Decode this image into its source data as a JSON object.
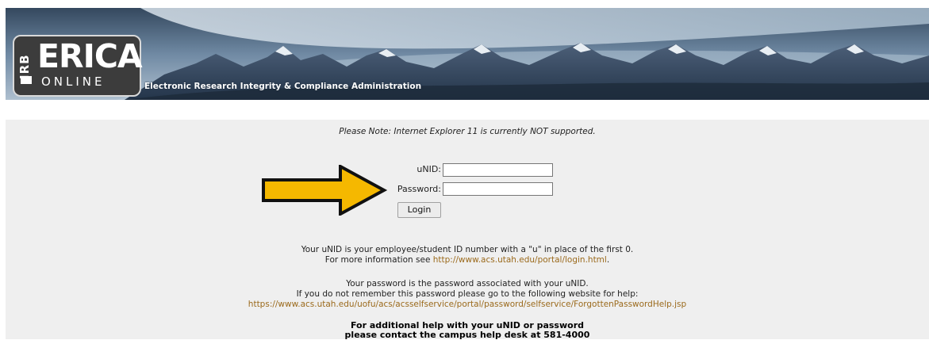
{
  "banner": {
    "logo_side_text": "IRB",
    "logo_main_text": "ERICA",
    "logo_sub_text": "ONLINE",
    "tagline": "Electronic Research Integrity & Compliance Administration"
  },
  "note": "Please Note: Internet Explorer 11 is currently NOT supported.",
  "login": {
    "unid_label": "uNID:",
    "unid_value": "",
    "password_label": "Password:",
    "password_value": "",
    "button_label": "Login"
  },
  "annotation": {
    "arrow_color": "#f5b800",
    "arrow_outline": "#111111"
  },
  "info": {
    "unid_line1": "Your uNID is your employee/student ID number with a \"u\" in place of the first 0.",
    "unid_line2_prefix": "For more information see ",
    "unid_link": "http://www.acs.utah.edu/portal/login.html",
    "unid_line2_suffix": ".",
    "pw_line1": "Your password is the password associated with your uNID.",
    "pw_line2": "If you do not remember this password please go to the following website for help:",
    "pw_link": "https://www.acs.utah.edu/uofu/acs/acsselfservice/portal/password/selfservice/ForgottenPasswordHelp.jsp",
    "help_line1": "For additional help with your uNID or password",
    "help_line2": "please contact the campus help desk at 581-4000"
  },
  "colors": {
    "link": "#9b6a1c",
    "panel_bg": "#efefef"
  }
}
